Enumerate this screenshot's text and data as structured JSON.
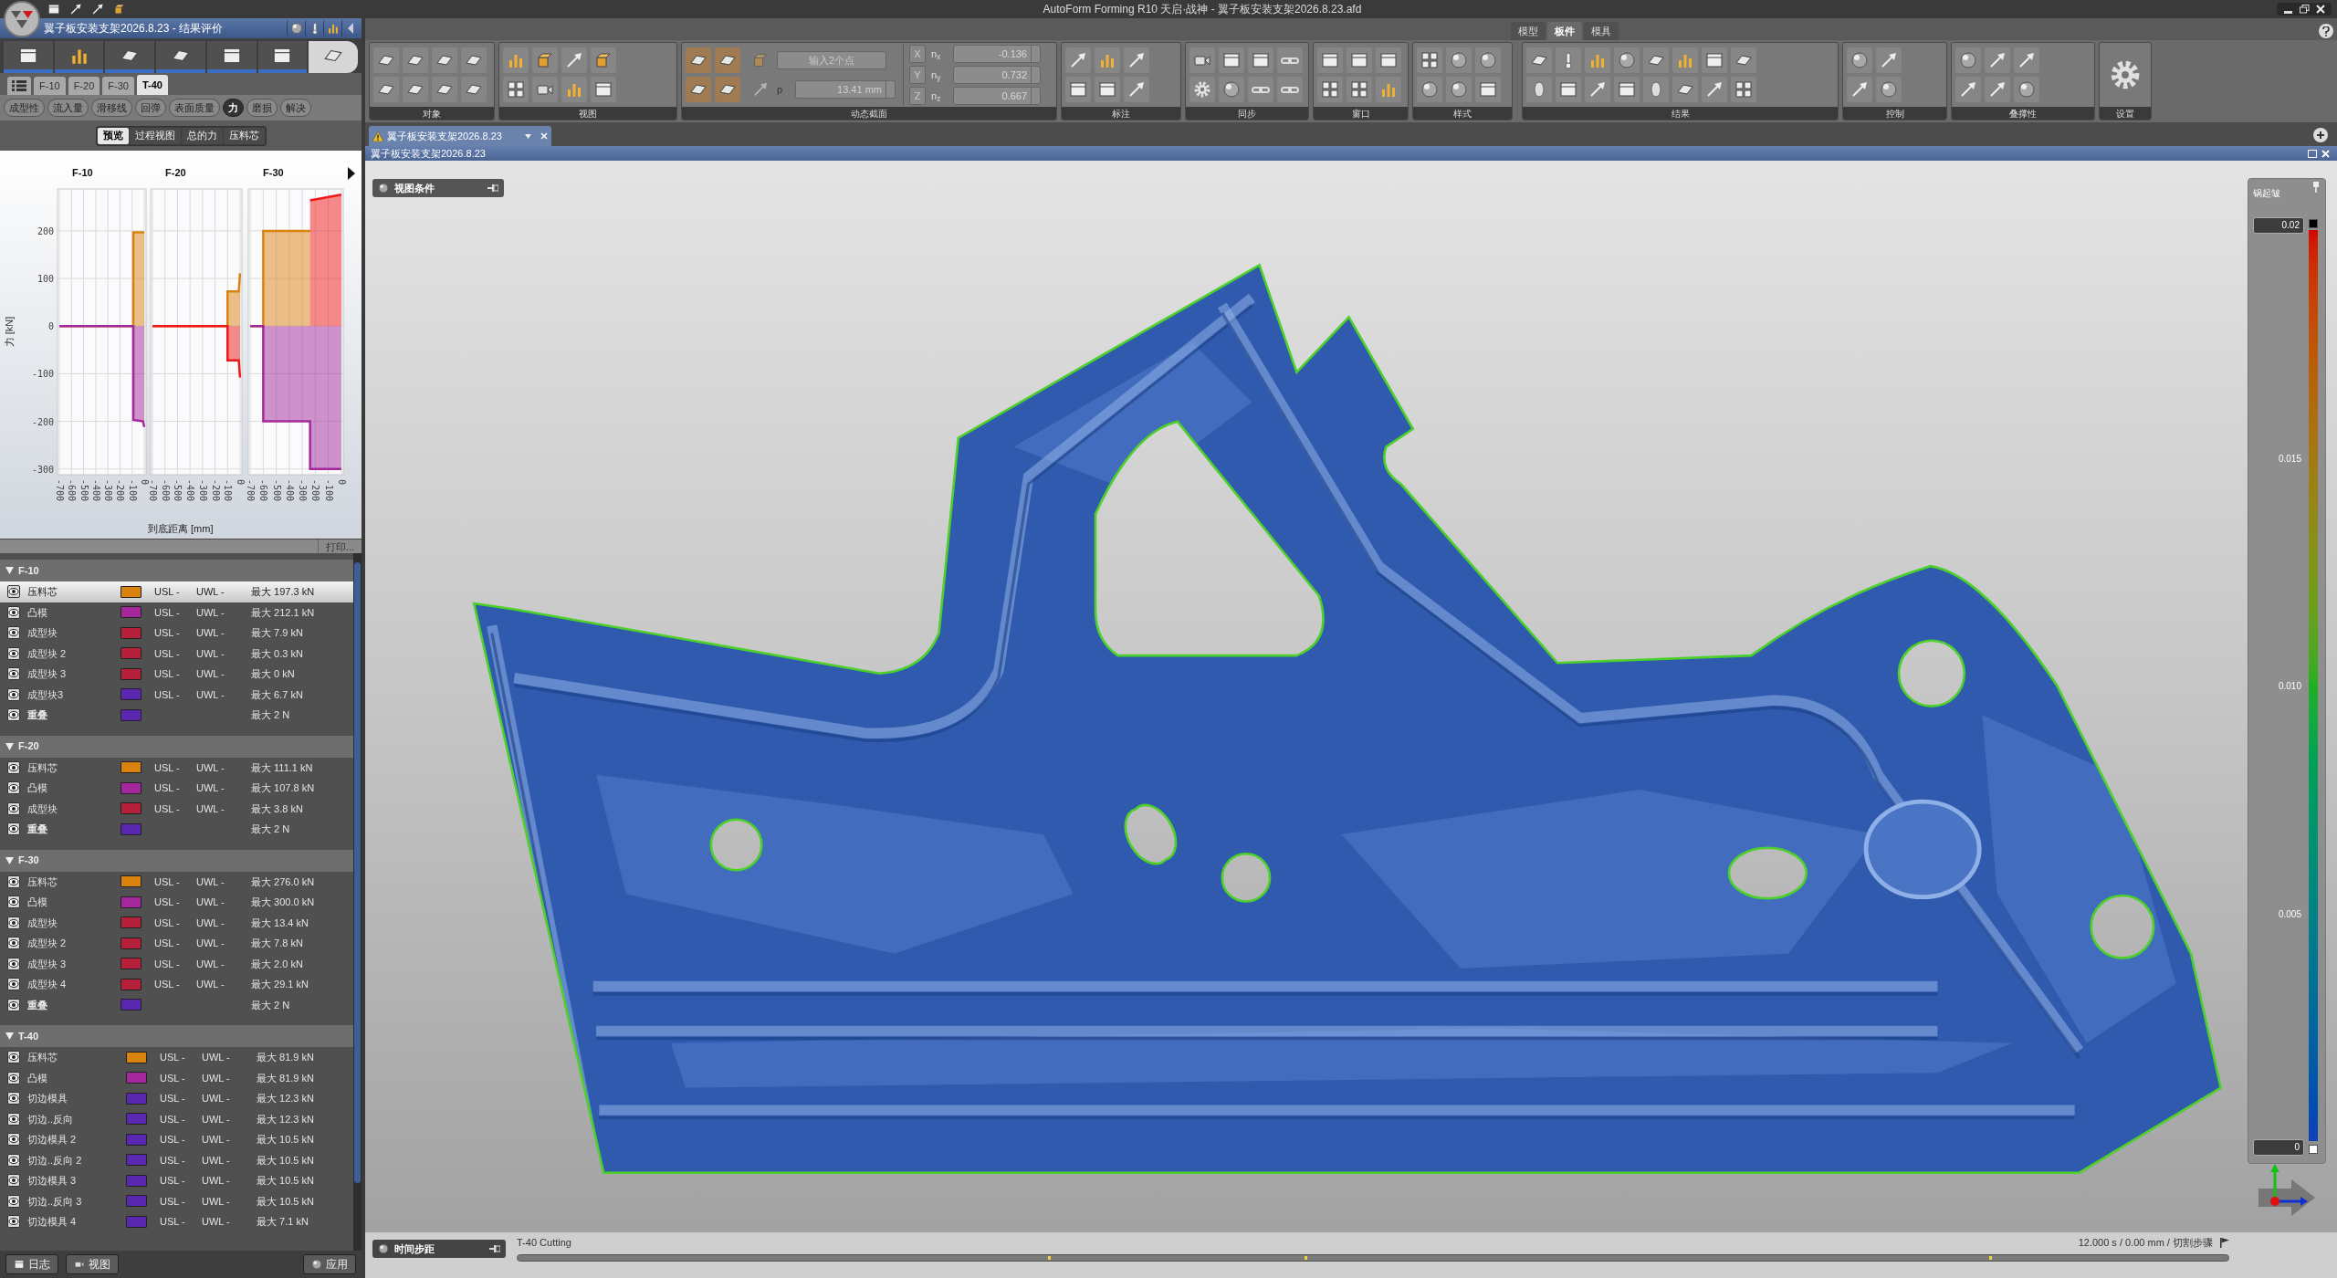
{
  "title_bar": {
    "title": "AutoForm Forming R10 天启·战神 - 翼子板安装支架2026.8.23.afd"
  },
  "left_panel": {
    "title": "翼子板安装支架2026.8.23 - 结果评价",
    "workflow_steps": [
      {
        "completed": true,
        "selected": false
      },
      {
        "completed": true,
        "selected": false
      },
      {
        "completed": true,
        "selected": false
      },
      {
        "completed": true,
        "selected": false
      },
      {
        "completed": true,
        "selected": false
      },
      {
        "completed": true,
        "selected": false
      },
      {
        "completed": false,
        "selected": true
      }
    ],
    "operation_tabs": [
      {
        "label": "F-10",
        "selected": false
      },
      {
        "label": "F-20",
        "selected": false
      },
      {
        "label": "F-30",
        "selected": false
      },
      {
        "label": "T-40",
        "selected": true
      }
    ],
    "result_types": [
      {
        "label": "成型性",
        "selected": false
      },
      {
        "label": "流入量",
        "selected": false
      },
      {
        "label": "滑移线",
        "selected": false
      },
      {
        "label": "回弹",
        "selected": false
      },
      {
        "label": "表面质量",
        "selected": false
      },
      {
        "label": "力",
        "selected": true
      },
      {
        "label": "磨损",
        "selected": false
      },
      {
        "label": "解决",
        "selected": false
      }
    ],
    "view_tabs": [
      {
        "label": "预览",
        "selected": true
      },
      {
        "label": "过程视图",
        "selected": false
      },
      {
        "label": "总的力",
        "selected": false
      },
      {
        "label": "压料芯",
        "selected": false
      }
    ],
    "charts": [
      {
        "chart_data": {
          "type": "area",
          "title": "F-10",
          "ylabel": "力 [kN]",
          "x": [
            -700,
            -90,
            -90,
            -10,
            0
          ],
          "xlim": [
            -715,
            15
          ],
          "ylim": [
            -312,
            288
          ],
          "xticks": [
            -700,
            -600,
            -500,
            -400,
            -300,
            -200,
            -100,
            0
          ],
          "yticks": [
            -300,
            -200,
            -100,
            0,
            100,
            200
          ],
          "grid": true,
          "series": [
            {
              "color": "#d9820f",
              "values": [
                0,
                0,
                197,
                197,
                197
              ]
            },
            {
              "color": "#a4279b",
              "values": [
                0,
                0,
                -197,
                -200,
                -212
              ]
            }
          ]
        }
      },
      {
        "chart_data": {
          "type": "area",
          "title": "F-20",
          "xlabel": "到底距离 [mm]",
          "x": [
            -700,
            -100,
            -100,
            -10,
            0
          ],
          "xlim": [
            -715,
            15
          ],
          "ylim": [
            -312,
            288
          ],
          "xticks": [
            -700,
            -600,
            -500,
            -400,
            -300,
            -200,
            -100,
            0
          ],
          "grid": true,
          "series": [
            {
              "color": "#d9820f",
              "values": [
                0,
                0,
                73,
                73,
                111
              ]
            },
            {
              "color": "#f01818",
              "values": [
                0,
                0,
                -72,
                -72,
                -108
              ]
            }
          ]
        }
      },
      {
        "chart_data": {
          "type": "area",
          "title": "F-30",
          "x": [
            -700,
            -600,
            -600,
            -240,
            -240,
            0
          ],
          "xlim": [
            -715,
            15
          ],
          "ylim": [
            -312,
            288
          ],
          "xticks": [
            -700,
            -600,
            -500,
            -400,
            -300,
            -200,
            -100,
            0
          ],
          "grid": true,
          "series": [
            {
              "color": "#d9820f",
              "values": [
                0,
                0,
                200,
                200,
                null,
                null
              ]
            },
            {
              "color": "#f01818",
              "values": [
                null,
                null,
                null,
                null,
                264,
                276
              ]
            },
            {
              "color": "#a4279b",
              "values": [
                0,
                0,
                -200,
                -200,
                -300,
                -300
              ]
            }
          ]
        }
      }
    ],
    "print_button": "打印...",
    "groups": [
      {
        "label": "F-10",
        "expanded": true,
        "rows": [
          {
            "kind": "tool",
            "name": "压料芯",
            "color": "#d9820f",
            "usl": "USL -",
            "uwl": "UWL -",
            "max": "最大 197.3 kN",
            "selected": true,
            "visible": true
          },
          {
            "kind": "tool",
            "name": "凸模",
            "color": "#a4279b",
            "usl": "USL -",
            "uwl": "UWL -",
            "max": "最大 212.1 kN",
            "selected": false,
            "visible": true
          },
          {
            "kind": "tool",
            "name": "成型块",
            "color": "#b5203a",
            "usl": "USL -",
            "uwl": "UWL -",
            "max": "最大 7.9 kN",
            "selected": false,
            "visible": true
          },
          {
            "kind": "tool",
            "name": "成型块 2",
            "color": "#b5203a",
            "usl": "USL -",
            "uwl": "UWL -",
            "max": "最大 0.3 kN",
            "selected": false,
            "visible": true
          },
          {
            "kind": "tool",
            "name": "成型块 3",
            "color": "#b5203a",
            "usl": "USL -",
            "uwl": "UWL -",
            "max": "最大 0 kN",
            "selected": false,
            "visible": true
          },
          {
            "kind": "tool",
            "name": "成型块3",
            "color": "#5a28b0",
            "usl": "USL -",
            "uwl": "UWL -",
            "max": "最大 6.7 kN",
            "selected": false,
            "visible": true
          },
          {
            "kind": "summary",
            "name": "重叠",
            "color": "#5a28b0",
            "max": "最大 2 N",
            "selected": false,
            "visible": true
          }
        ]
      },
      {
        "label": "F-20",
        "expanded": true,
        "rows": [
          {
            "kind": "tool",
            "name": "压料芯",
            "color": "#d9820f",
            "usl": "USL -",
            "uwl": "UWL -",
            "max": "最大 111.1 kN",
            "selected": false,
            "visible": true
          },
          {
            "kind": "tool",
            "name": "凸模",
            "color": "#a4279b",
            "usl": "USL -",
            "uwl": "UWL -",
            "max": "最大 107.8 kN",
            "selected": false,
            "visible": true
          },
          {
            "kind": "tool",
            "name": "成型块",
            "color": "#b5203a",
            "usl": "USL -",
            "uwl": "UWL -",
            "max": "最大 3.8 kN",
            "selected": false,
            "visible": true
          },
          {
            "kind": "summary",
            "name": "重叠",
            "color": "#5a28b0",
            "max": "最大 2 N",
            "selected": false,
            "visible": true
          }
        ]
      },
      {
        "label": "F-30",
        "expanded": true,
        "rows": [
          {
            "kind": "tool",
            "name": "压料芯",
            "color": "#d9820f",
            "usl": "USL -",
            "uwl": "UWL -",
            "max": "最大 276.0 kN",
            "selected": false,
            "visible": true
          },
          {
            "kind": "tool",
            "name": "凸模",
            "color": "#a4279b",
            "usl": "USL -",
            "uwl": "UWL -",
            "max": "最大 300.0 kN",
            "selected": false,
            "visible": true
          },
          {
            "kind": "tool",
            "name": "成型块",
            "color": "#b5203a",
            "usl": "USL -",
            "uwl": "UWL -",
            "max": "最大 13.4 kN",
            "selected": false,
            "visible": true
          },
          {
            "kind": "tool",
            "name": "成型块 2",
            "color": "#b5203a",
            "usl": "USL -",
            "uwl": "UWL -",
            "max": "最大 7.8 kN",
            "selected": false,
            "visible": true
          },
          {
            "kind": "tool",
            "name": "成型块 3",
            "color": "#b5203a",
            "usl": "USL -",
            "uwl": "UWL -",
            "max": "最大 2.0 kN",
            "selected": false,
            "visible": true
          },
          {
            "kind": "tool",
            "name": "成型块 4",
            "color": "#b5203a",
            "usl": "USL -",
            "uwl": "UWL -",
            "max": "最大 29.1 kN",
            "selected": false,
            "visible": true
          },
          {
            "kind": "summary",
            "name": "重叠",
            "color": "#5a28b0",
            "max": "最大 2 N",
            "selected": false,
            "visible": true
          }
        ]
      },
      {
        "label": "T-40",
        "expanded": true,
        "rows": [
          {
            "kind": "tool",
            "name": "压料芯",
            "color": "#d9820f",
            "usl": "USL -",
            "uwl": "UWL -",
            "max": "最大 81.9 kN",
            "selected": false,
            "visible": true
          },
          {
            "kind": "tool",
            "name": "凸模",
            "color": "#a4279b",
            "usl": "USL -",
            "uwl": "UWL -",
            "max": "最大 81.9 kN",
            "selected": false,
            "visible": true
          },
          {
            "kind": "tool",
            "name": "切边模具",
            "color": "#5a28b0",
            "usl": "USL -",
            "uwl": "UWL -",
            "max": "最大 12.3 kN",
            "selected": false,
            "visible": true
          },
          {
            "kind": "tool",
            "name": "切边..反向",
            "color": "#5a28b0",
            "usl": "USL -",
            "uwl": "UWL -",
            "max": "最大 12.3 kN",
            "selected": false,
            "visible": true
          },
          {
            "kind": "tool",
            "name": "切边模具 2",
            "color": "#5a28b0",
            "usl": "USL -",
            "uwl": "UWL -",
            "max": "最大 10.5 kN",
            "selected": false,
            "visible": true
          },
          {
            "kind": "tool",
            "name": "切边..反向 2",
            "color": "#5a28b0",
            "usl": "USL -",
            "uwl": "UWL -",
            "max": "最大 10.5 kN",
            "selected": false,
            "visible": true
          },
          {
            "kind": "tool",
            "name": "切边模具 3",
            "color": "#5a28b0",
            "usl": "USL -",
            "uwl": "UWL -",
            "max": "最大 10.5 kN",
            "selected": false,
            "visible": true
          },
          {
            "kind": "tool",
            "name": "切边..反向 3",
            "color": "#5a28b0",
            "usl": "USL -",
            "uwl": "UWL -",
            "max": "最大 10.5 kN",
            "selected": false,
            "visible": true
          },
          {
            "kind": "tool",
            "name": "切边模具 4",
            "color": "#5a28b0",
            "usl": "USL -",
            "uwl": "UWL -",
            "max": "最大 7.1 kN",
            "selected": false,
            "visible": true
          }
        ]
      }
    ],
    "footer_buttons": [
      {
        "label": "日志"
      },
      {
        "label": "视图"
      },
      {
        "label": "应用"
      }
    ]
  },
  "ribbon": {
    "tabs": [
      {
        "label": "模型",
        "selected": false
      },
      {
        "label": "板件",
        "selected": true
      },
      {
        "label": "模具",
        "selected": false
      }
    ],
    "groups": [
      {
        "label": "对象",
        "kind": "icons"
      },
      {
        "label": "视图",
        "kind": "icons"
      },
      {
        "label": "动态截面",
        "kind": "section"
      },
      {
        "label": "标注",
        "kind": "icons"
      },
      {
        "label": "同步",
        "kind": "icons"
      },
      {
        "label": "窗口",
        "kind": "icons"
      },
      {
        "label": "样式",
        "kind": "icons"
      },
      {
        "label": "结果",
        "kind": "icons"
      },
      {
        "label": "控制",
        "kind": "icons"
      },
      {
        "label": "叠撑性",
        "kind": "icons"
      },
      {
        "label": "设置",
        "kind": "settings"
      }
    ],
    "section": {
      "point_button": "输入2个点",
      "p_label": "p",
      "p_value": "13.41 mm",
      "axes": [
        {
          "axis": "X",
          "normal_label": "n$_{x}$",
          "value": "-0.136"
        },
        {
          "axis": "Y",
          "normal_label": "n$_{y}$",
          "value": "0.732"
        },
        {
          "axis": "Z",
          "normal_label": "n$_{z}$",
          "value": "0.667"
        }
      ]
    }
  },
  "document_tab": {
    "title": "翼子板安装支架2026.8.23"
  },
  "viewport": {
    "title": "翼子板安装支架2026.8.23",
    "view_chip": "视图条件",
    "legend": {
      "title": "锅起皱",
      "max": "0.02",
      "ticks": [
        "0.015",
        "0.010",
        "0.005"
      ],
      "min": "0"
    }
  },
  "timeline": {
    "label": "时间步距",
    "step": "T-40 Cutting",
    "status": "12.000 s / 0.00 mm / 切割步骤"
  }
}
